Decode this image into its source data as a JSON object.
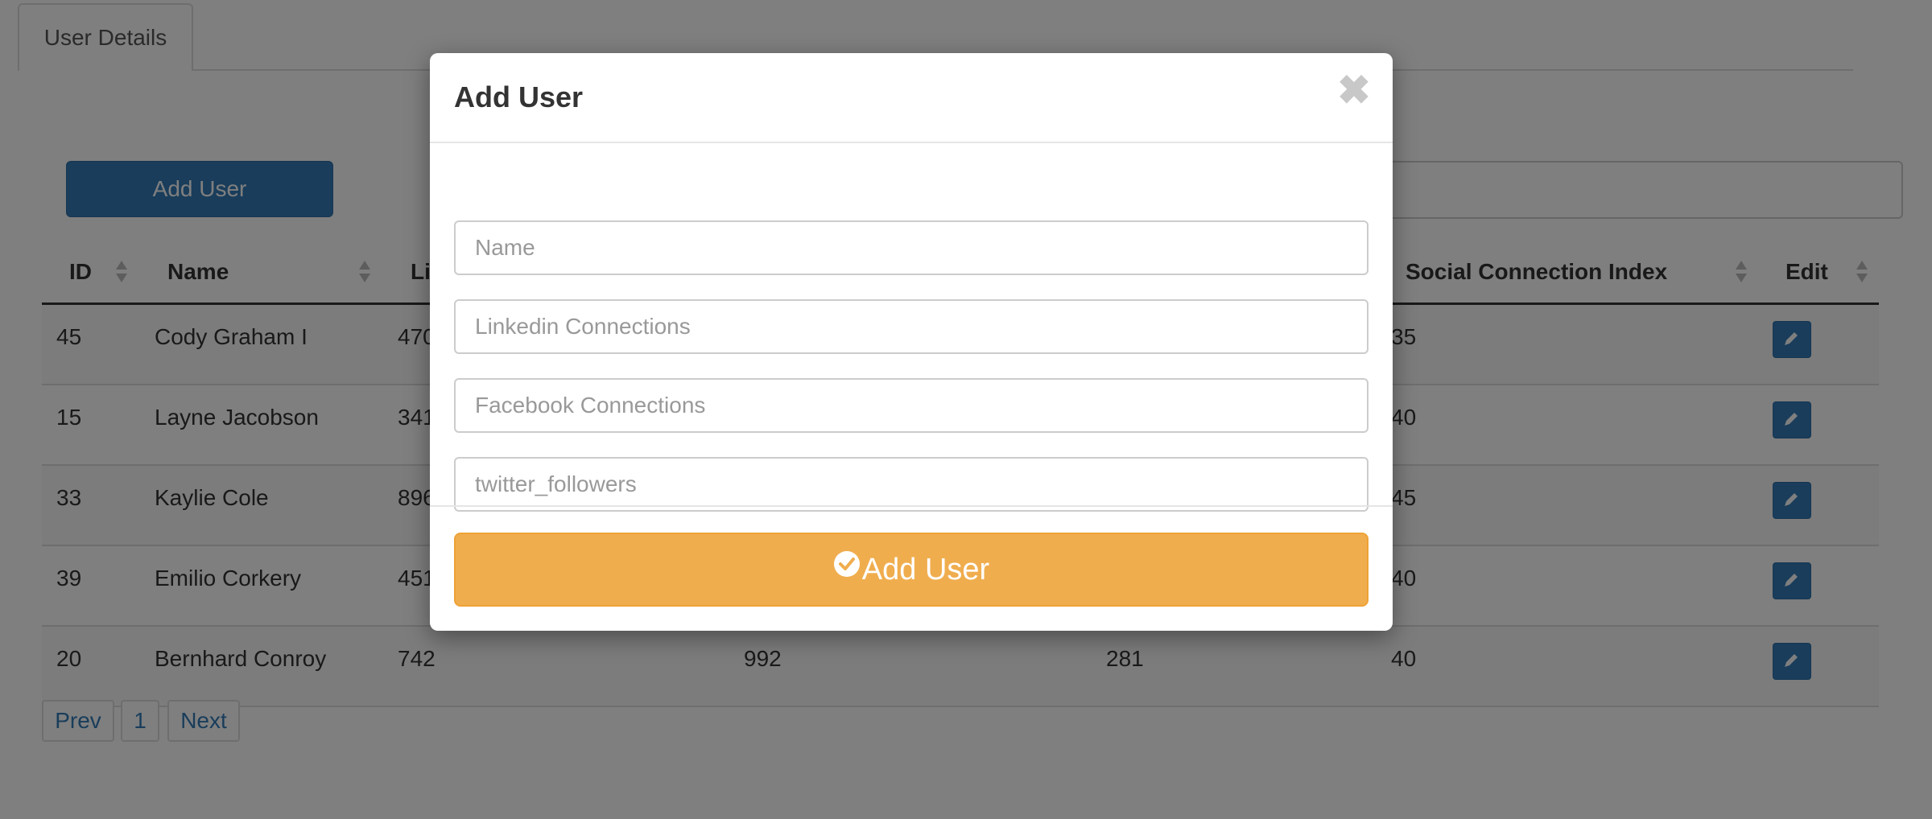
{
  "tabs": [
    {
      "label": "User Details"
    }
  ],
  "toolbar": {
    "add_label": "Add User"
  },
  "table": {
    "headers": [
      "ID",
      "Name",
      "Li",
      "Social Connection Index",
      "Edit"
    ],
    "rows": [
      {
        "id": "45",
        "name": "Cody Graham I",
        "linkedin": "470",
        "facebook": "",
        "twitter": "",
        "index": "35"
      },
      {
        "id": "15",
        "name": "Layne Jacobson",
        "linkedin": "341",
        "facebook": "",
        "twitter": "",
        "index": "40"
      },
      {
        "id": "33",
        "name": "Kaylie Cole",
        "linkedin": "896",
        "facebook": "",
        "twitter": "",
        "index": "45"
      },
      {
        "id": "39",
        "name": "Emilio Corkery",
        "linkedin": "451",
        "facebook": "",
        "twitter": "",
        "index": "40"
      },
      {
        "id": "20",
        "name": "Bernhard Conroy",
        "linkedin": "742",
        "facebook": "992",
        "twitter": "281",
        "index": "40"
      }
    ]
  },
  "pagination": {
    "prev": "Prev",
    "page": "1",
    "next": "Next"
  },
  "modal": {
    "title": "Add User",
    "close_symbol": "✖",
    "fields": {
      "name_placeholder": "Name",
      "linkedin_placeholder": "Linkedin Connections",
      "facebook_placeholder": "Facebook Connections",
      "twitter_placeholder": "twitter_followers"
    },
    "submit_label": "Add User"
  },
  "colors": {
    "primary": "#337ab7",
    "warning": "#f0ad4e",
    "overlay": "rgba(0,0,0,0.5)"
  }
}
